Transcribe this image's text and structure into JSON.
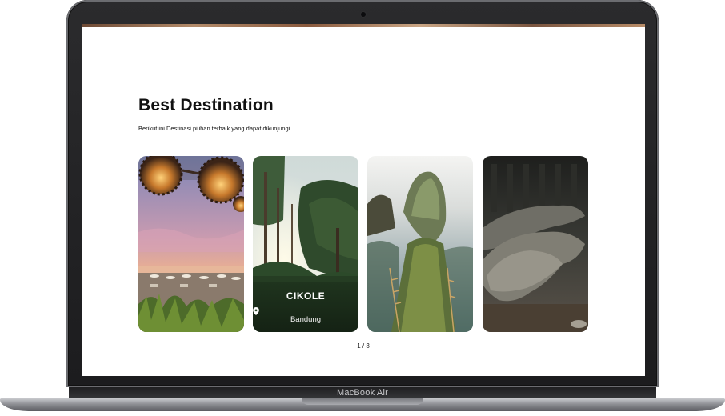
{
  "device": {
    "brand_label": "MacBook Air"
  },
  "page": {
    "title": "Best Destination",
    "subtitle": "Berikut ini Destinasi pilihan terbaik yang dapat dikunjungi"
  },
  "cards": [
    {
      "scene": "beach-lanterns"
    },
    {
      "scene": "pine-forest",
      "name": "CIKOLE",
      "location": "Bandung",
      "location_icon": "map-pin-icon"
    },
    {
      "scene": "sea-cliff"
    },
    {
      "scene": "komodo-dragons"
    }
  ],
  "pagination": {
    "label": "1 / 3"
  }
}
